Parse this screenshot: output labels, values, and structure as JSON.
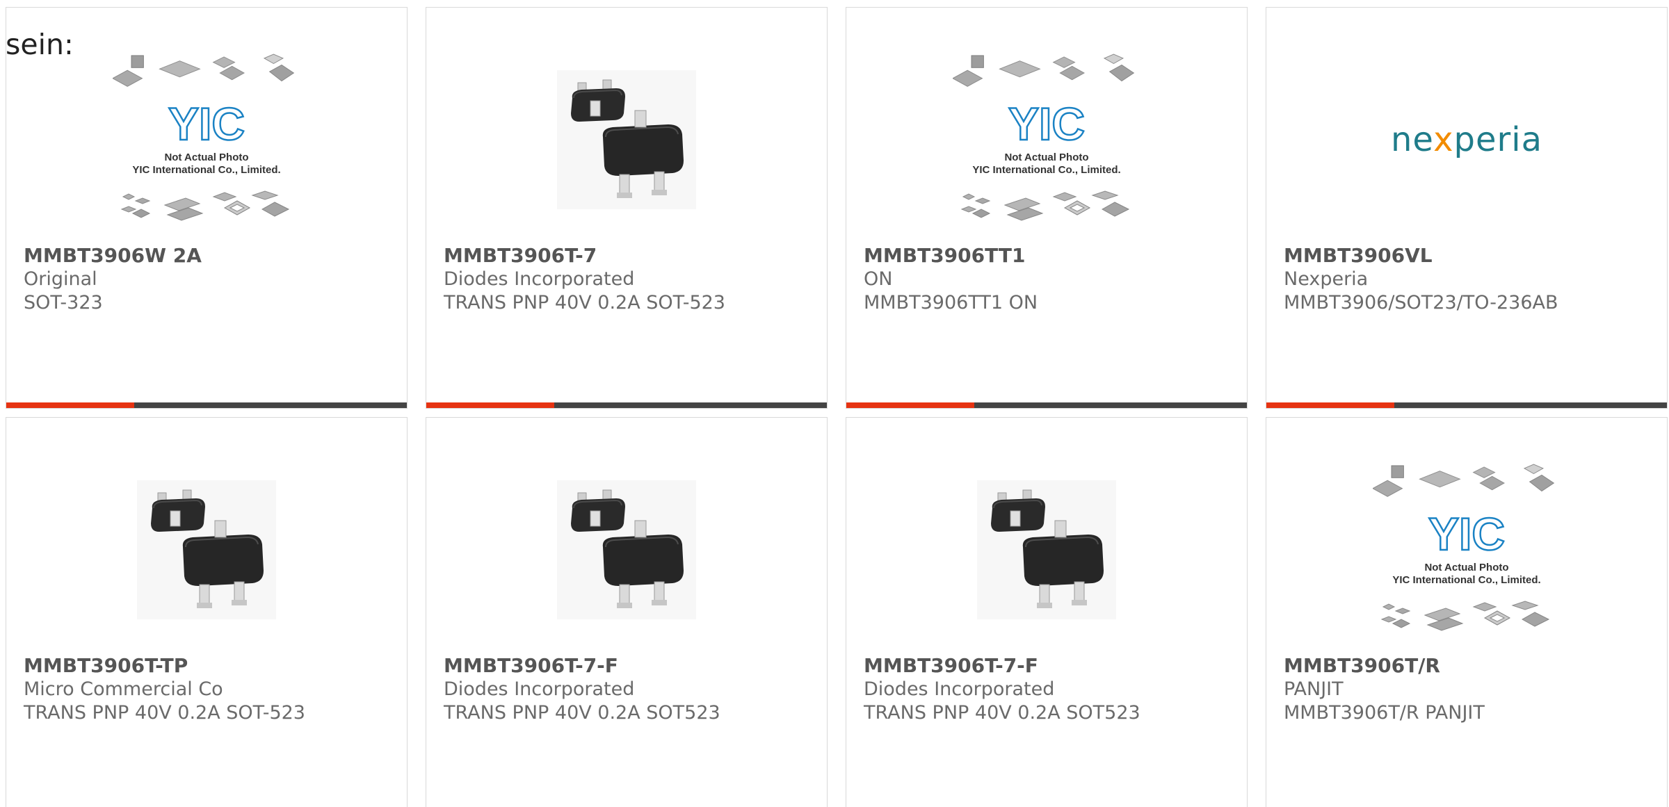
{
  "intro": {
    "text": "sein:"
  },
  "logo_text": {
    "yic_brand": "YIC",
    "yic_line1": "Not Actual Photo",
    "yic_line2": "YIC International Co., Limited.",
    "nexperia_pre": "ne",
    "nexperia_x": "x",
    "nexperia_post": "peria"
  },
  "colors": {
    "accent": "#e63312",
    "bar": "#444444",
    "border": "#d9d9d9",
    "nexperia_teal": "#1f7c8a",
    "nexperia_orange": "#f28c00",
    "yic_blue": "#1a82c4"
  },
  "products": [
    {
      "part": "MMBT3906W 2A",
      "manufacturer": "Original",
      "description": "SOT-323",
      "image": "yic-placeholder-icon"
    },
    {
      "part": "MMBT3906T-7",
      "manufacturer": "Diodes Incorporated",
      "description": "TRANS PNP 40V 0.2A SOT-523",
      "image": "transistor-package-icon"
    },
    {
      "part": "MMBT3906TT1",
      "manufacturer": "ON",
      "description": "MMBT3906TT1 ON",
      "image": "yic-placeholder-icon"
    },
    {
      "part": "MMBT3906VL",
      "manufacturer": "Nexperia",
      "description": "MMBT3906/SOT23/TO-236AB",
      "image": "nexperia-logo"
    },
    {
      "part": "MMBT3906T-TP",
      "manufacturer": "Micro Commercial Co",
      "description": "TRANS PNP 40V 0.2A SOT-523",
      "image": "transistor-package-icon"
    },
    {
      "part": "MMBT3906T-7-F",
      "manufacturer": "Diodes Incorporated",
      "description": "TRANS PNP 40V 0.2A SOT523",
      "image": "transistor-package-icon"
    },
    {
      "part": "MMBT3906T-7-F",
      "manufacturer": "Diodes Incorporated",
      "description": "TRANS PNP 40V 0.2A SOT523",
      "image": "transistor-package-icon"
    },
    {
      "part": "MMBT3906T/R",
      "manufacturer": "PANJIT",
      "description": "MMBT3906T/R PANJIT",
      "image": "yic-placeholder-icon"
    }
  ]
}
